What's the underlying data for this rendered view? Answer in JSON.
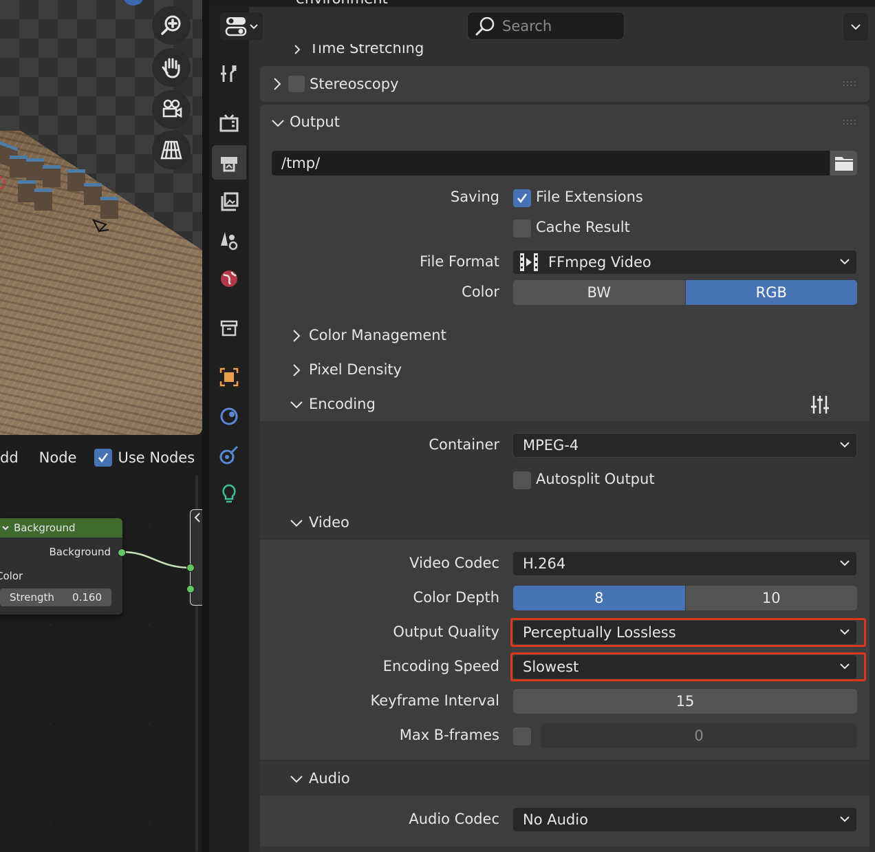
{
  "top_bar": {
    "header_text": "environment",
    "search_placeholder": "Search"
  },
  "node_editor": {
    "menu": {
      "add": "dd",
      "node": "Node",
      "use_nodes": "Use Nodes",
      "use_nodes_checked": true
    },
    "background_node": {
      "title": "Background",
      "output_label": "Background",
      "color_label": "Color",
      "strength_label": "Strength",
      "strength_value": "0.160"
    }
  },
  "properties": {
    "time_stretching": "Time Stretching",
    "stereoscopy": "Stereoscopy",
    "output_panel": {
      "title": "Output",
      "path": "/tmp/",
      "saving_label": "Saving",
      "file_extensions": "File Extensions",
      "file_extensions_checked": true,
      "cache_result": "Cache Result",
      "cache_result_checked": false,
      "file_format_label": "File Format",
      "file_format": "FFmpeg Video",
      "color_label": "Color",
      "color_options": [
        "BW",
        "RGB"
      ],
      "color_selected": "RGB",
      "color_management": "Color Management",
      "pixel_density": "Pixel Density"
    },
    "encoding": {
      "title": "Encoding",
      "container_label": "Container",
      "container": "MPEG-4",
      "autosplit": "Autosplit Output",
      "autosplit_checked": false
    },
    "video": {
      "title": "Video",
      "codec_label": "Video Codec",
      "codec": "H.264",
      "depth_label": "Color Depth",
      "depth_options": [
        "8",
        "10"
      ],
      "depth_selected": "8",
      "quality_label": "Output Quality",
      "quality": "Perceptually Lossless",
      "speed_label": "Encoding Speed",
      "speed": "Slowest",
      "keyframe_label": "Keyframe Interval",
      "keyframe": "15",
      "bframes_label": "Max B-frames",
      "bframes": "0"
    },
    "audio": {
      "title": "Audio",
      "codec_label": "Audio Codec",
      "codec": "No Audio"
    }
  },
  "colors": {
    "accent": "#4772b3",
    "highlight": "#e0361e",
    "node_header": "#3e6a2e",
    "socket": "#63c763"
  }
}
